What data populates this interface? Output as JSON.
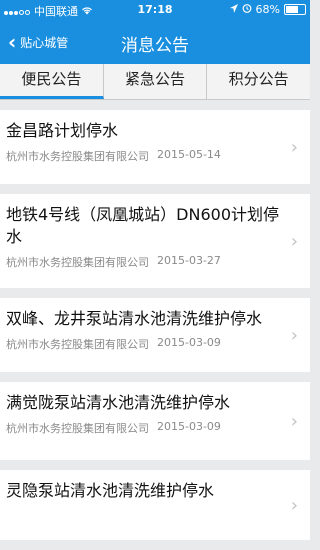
{
  "status_bar": {
    "carrier": "中国联通",
    "time": "17:18",
    "battery": "68%",
    "battery_level": 0.68
  },
  "nav": {
    "back_label": "贴心城管",
    "title": "消息公告"
  },
  "tabs": [
    {
      "label": "便民公告",
      "active": true
    },
    {
      "label": "紧急公告",
      "active": false
    },
    {
      "label": "积分公告",
      "active": false
    }
  ],
  "notices": [
    {
      "title": "金昌路计划停水",
      "source": "杭州市水务控股集团有限公司",
      "date": "2015-05-14"
    },
    {
      "title": "地铁4号线（凤凰城站）DN600计划停水",
      "source": "杭州市水务控股集团有限公司",
      "date": "2015-03-27"
    },
    {
      "title": "双峰、龙井泵站清水池清洗维护停水",
      "source": "杭州市水务控股集团有限公司",
      "date": "2015-03-09"
    },
    {
      "title": "满觉陇泵站清水池清洗维护停水",
      "source": "杭州市水务控股集团有限公司",
      "date": "2015-03-09"
    },
    {
      "title": "灵隐泵站清水池清洗维护停水",
      "source": "",
      "date": ""
    }
  ],
  "colors": {
    "accent": "#1a8fdf"
  }
}
